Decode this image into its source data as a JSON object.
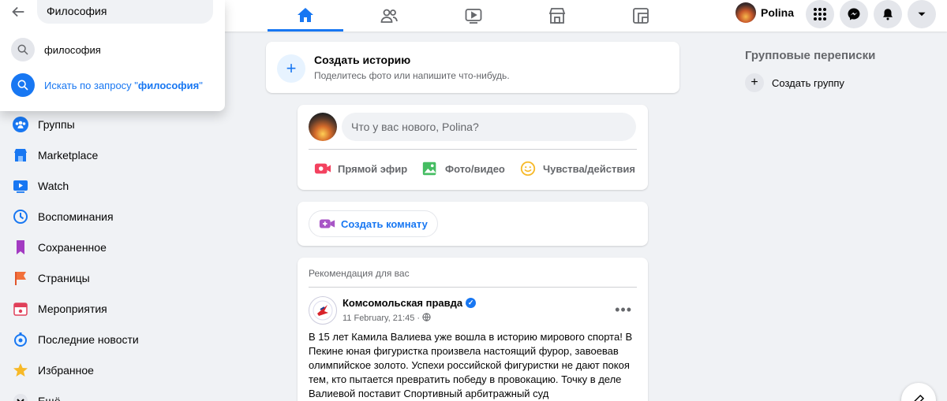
{
  "search": {
    "value": "Философия",
    "suggestion": "философия",
    "query_prefix": "Искать по запросу \"",
    "query_term": "философия",
    "query_suffix": "\""
  },
  "user": {
    "name": "Polina"
  },
  "sidebar": {
    "items": [
      {
        "label": "Группы",
        "icon": "groups-icon"
      },
      {
        "label": "Marketplace",
        "icon": "marketplace-icon"
      },
      {
        "label": "Watch",
        "icon": "watch-icon"
      },
      {
        "label": "Воспоминания",
        "icon": "memories-icon"
      },
      {
        "label": "Сохраненное",
        "icon": "saved-icon"
      },
      {
        "label": "Страницы",
        "icon": "pages-icon"
      },
      {
        "label": "Мероприятия",
        "icon": "events-icon"
      },
      {
        "label": "Последние новости",
        "icon": "news-icon"
      },
      {
        "label": "Избранное",
        "icon": "favorites-icon"
      },
      {
        "label": "Ещё",
        "icon": "more-icon"
      }
    ]
  },
  "story": {
    "title": "Создать историю",
    "subtitle": "Поделитесь фото или напишите что-нибудь."
  },
  "composer": {
    "placeholder": "Что у вас нового, Polina?",
    "live": "Прямой эфир",
    "photo": "Фото/видео",
    "feeling": "Чувства/действия"
  },
  "room": {
    "label": "Создать комнату"
  },
  "post": {
    "recommendation": "Рекомендация для вас",
    "author": "Комсомольская правда",
    "date": "11 February, 21:45 ·",
    "text": "В 15 лет Камила Валиева уже вошла в историю мирового спорта! В Пекине юная фигуристка произвела настоящий фурор, завоевав олимпийское золото. Успехи российской фигуристки не дают покоя тем, кто пытается превратить победу в провокацию. Точку в деле Валиевой поставит Спортивный арбитражный суд"
  },
  "right": {
    "title": "Групповые переписки",
    "create_group": "Создать группу"
  },
  "colors": {
    "accent": "#1877f2",
    "background": "#f0f2f5"
  }
}
